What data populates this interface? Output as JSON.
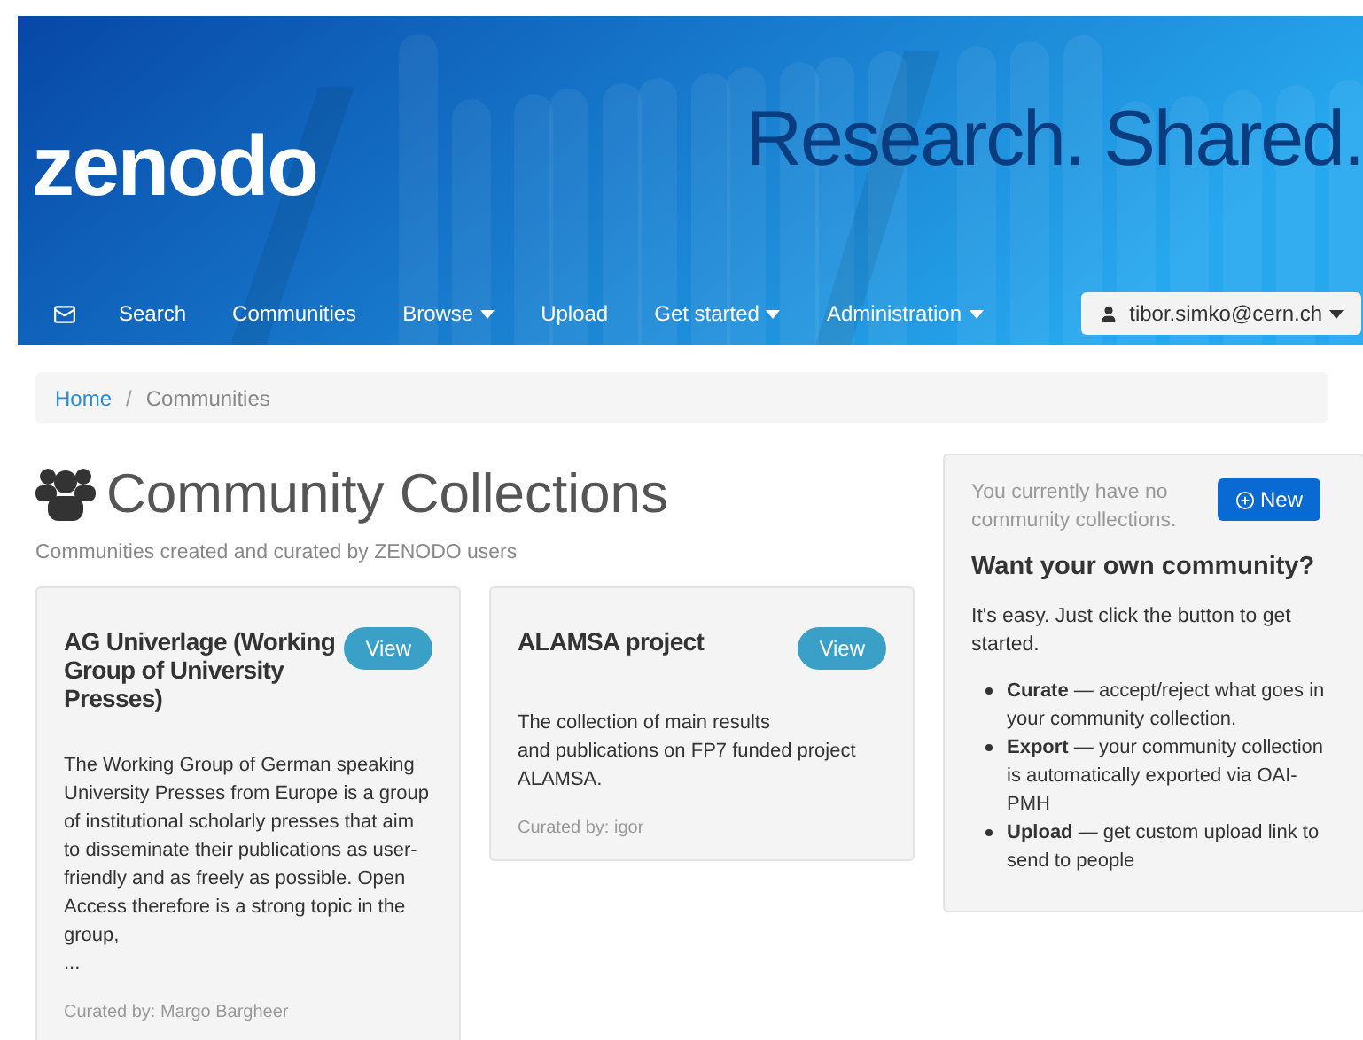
{
  "header": {
    "logo": "zenodo",
    "tagline": "Research. Shared.",
    "nav": [
      {
        "label": "Search",
        "caret": false
      },
      {
        "label": "Communities",
        "caret": false
      },
      {
        "label": "Browse",
        "caret": true
      },
      {
        "label": "Upload",
        "caret": false
      },
      {
        "label": "Get started",
        "caret": true
      },
      {
        "label": "Administration",
        "caret": true
      }
    ],
    "user": "tibor.simko@cern.ch"
  },
  "breadcrumb": [
    "Home",
    "Communities"
  ],
  "breadcrumb_separator": "/",
  "page": {
    "title": "Community Collections",
    "subtitle": "Communities created and curated by ZENODO users"
  },
  "communities": [
    {
      "title": "AG Univerlage (Working Group of University Presses)",
      "button": "View",
      "description": "The Working Group of German speaking University Presses from Europe is a group of institutional scholarly presses that aim to disseminate their publications as user-friendly and as freely as possible. Open Access therefore is a strong topic in the group,\n...",
      "curated": "Curated by: Margo Bargheer"
    },
    {
      "title": "ALAMSA project",
      "button": "View",
      "description": "The collection of main results\nand publications on FP7 funded project ALAMSA.",
      "curated": "Curated by: igor"
    }
  ],
  "sidebar": {
    "note": "You currently have no community collections.",
    "button": "New",
    "heading": "Want your own community?",
    "intro": "It's easy. Just click the button to get started.",
    "bullets": [
      "**Curate** — accept/reject what goes in your community collection.",
      "**Export** — your community collection is automatically exported via OAI-PMH",
      "**Upload** — get custom upload link to send to people"
    ]
  }
}
